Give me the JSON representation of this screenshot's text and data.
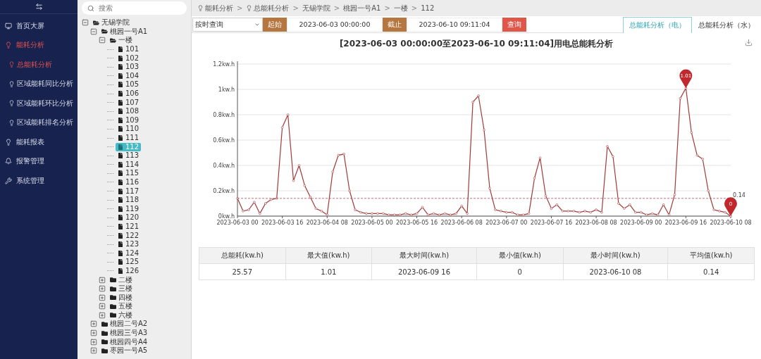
{
  "sidebar": {
    "items": [
      {
        "label": "首页大屏",
        "selected": false
      },
      {
        "label": "能耗分析",
        "selected": true,
        "children": [
          {
            "label": "总能耗分析",
            "selected": true
          },
          {
            "label": "区域能耗同比分析",
            "selected": false
          },
          {
            "label": "区域能耗环比分析",
            "selected": false
          },
          {
            "label": "区域能耗排名分析",
            "selected": false
          }
        ]
      },
      {
        "label": "能耗报表",
        "selected": false
      },
      {
        "label": "报警管理",
        "selected": false
      },
      {
        "label": "系统管理",
        "selected": false
      }
    ]
  },
  "tree": {
    "search": {
      "placeholder": "搜索"
    },
    "nodes": [
      {
        "label": "无锡学院",
        "kind": "folder",
        "expanded": true,
        "selected": false,
        "children": [
          {
            "label": "桃园一号A1",
            "kind": "folder",
            "expanded": true,
            "selected": false,
            "children": [
              {
                "label": "一楼",
                "kind": "folder",
                "expanded": true,
                "selected": false,
                "children": [
                  {
                    "label": "101",
                    "kind": "room",
                    "selected": false
                  },
                  {
                    "label": "102",
                    "kind": "room",
                    "selected": false
                  },
                  {
                    "label": "103",
                    "kind": "room",
                    "selected": false
                  },
                  {
                    "label": "104",
                    "kind": "room",
                    "selected": false
                  },
                  {
                    "label": "105",
                    "kind": "room",
                    "selected": false
                  },
                  {
                    "label": "106",
                    "kind": "room",
                    "selected": false
                  },
                  {
                    "label": "107",
                    "kind": "room",
                    "selected": false
                  },
                  {
                    "label": "108",
                    "kind": "room",
                    "selected": false
                  },
                  {
                    "label": "109",
                    "kind": "room",
                    "selected": false
                  },
                  {
                    "label": "110",
                    "kind": "room",
                    "selected": false
                  },
                  {
                    "label": "111",
                    "kind": "room",
                    "selected": false
                  },
                  {
                    "label": "112",
                    "kind": "room",
                    "selected": true
                  },
                  {
                    "label": "113",
                    "kind": "room",
                    "selected": false
                  },
                  {
                    "label": "114",
                    "kind": "room",
                    "selected": false
                  },
                  {
                    "label": "115",
                    "kind": "room",
                    "selected": false
                  },
                  {
                    "label": "116",
                    "kind": "room",
                    "selected": false
                  },
                  {
                    "label": "117",
                    "kind": "room",
                    "selected": false
                  },
                  {
                    "label": "118",
                    "kind": "room",
                    "selected": false
                  },
                  {
                    "label": "119",
                    "kind": "room",
                    "selected": false
                  },
                  {
                    "label": "120",
                    "kind": "room",
                    "selected": false
                  },
                  {
                    "label": "121",
                    "kind": "room",
                    "selected": false
                  },
                  {
                    "label": "122",
                    "kind": "room",
                    "selected": false
                  },
                  {
                    "label": "123",
                    "kind": "room",
                    "selected": false
                  },
                  {
                    "label": "124",
                    "kind": "room",
                    "selected": false
                  },
                  {
                    "label": "125",
                    "kind": "room",
                    "selected": false
                  },
                  {
                    "label": "126",
                    "kind": "room",
                    "selected": false
                  }
                ]
              },
              {
                "label": "二楼",
                "kind": "folder",
                "expanded": false,
                "selected": false
              },
              {
                "label": "三楼",
                "kind": "folder",
                "expanded": false,
                "selected": false
              },
              {
                "label": "四楼",
                "kind": "folder",
                "expanded": false,
                "selected": false
              },
              {
                "label": "五楼",
                "kind": "folder",
                "expanded": false,
                "selected": false
              },
              {
                "label": "六楼",
                "kind": "folder",
                "expanded": false,
                "selected": false
              }
            ]
          },
          {
            "label": "桃园二号A2",
            "kind": "folder",
            "expanded": false,
            "selected": false
          },
          {
            "label": "桃园三号A3",
            "kind": "folder",
            "expanded": false,
            "selected": false
          },
          {
            "label": "桃园四号A4",
            "kind": "folder",
            "expanded": false,
            "selected": false
          },
          {
            "label": "枣园一号A5",
            "kind": "folder",
            "expanded": false,
            "selected": false
          }
        ]
      }
    ]
  },
  "breadcrumb": {
    "separator": ">",
    "items": [
      "能耗分析",
      "总能耗分析",
      "无锡学院",
      "桃园一号A1",
      "一楼",
      "112"
    ]
  },
  "toolbar": {
    "query_mode": "按时查询",
    "start": {
      "label": "起始",
      "value": "2023-06-03 00:00:00"
    },
    "end": {
      "label": "截止",
      "value": "2023-06-10 09:11:04"
    },
    "search_button": "查询"
  },
  "tabs": [
    {
      "label": "总能耗分析（电）",
      "selected": true
    },
    {
      "label": "总能耗分析（水）",
      "selected": false
    }
  ],
  "chart": {
    "title": "[2023-06-03 00:00:00至2023-06-10 09:11:04]用电总能耗分析",
    "chart_data": {
      "type": "line",
      "categories": [
        "2023-06-03 00",
        null,
        null,
        null,
        null,
        null,
        null,
        null,
        "2023-06-03 16",
        null,
        null,
        null,
        null,
        null,
        null,
        null,
        "2023-06-04 08",
        null,
        null,
        null,
        null,
        null,
        null,
        null,
        "2023-06-05 00",
        null,
        null,
        null,
        null,
        null,
        null,
        null,
        "2023-06-05 16",
        null,
        null,
        null,
        null,
        null,
        null,
        null,
        "2023-06-06 08",
        null,
        null,
        null,
        null,
        null,
        null,
        null,
        "2023-06-07 00",
        null,
        null,
        null,
        null,
        null,
        null,
        null,
        "2023-06-07 16",
        null,
        null,
        null,
        null,
        null,
        null,
        null,
        "2023-06-08 08",
        null,
        null,
        null,
        null,
        null,
        null,
        null,
        "2023-06-09 00",
        null,
        null,
        null,
        null,
        null,
        null,
        null,
        "2023-06-09 16",
        null,
        null,
        null,
        null,
        null,
        null,
        null,
        "2023-06-10 08"
      ],
      "grid": true,
      "series": [
        {
          "color": "#a33a3a",
          "marker": "o",
          "values": [
            0.14,
            0.04,
            0.05,
            0.11,
            0.02,
            0.1,
            0.13,
            0.14,
            0.7,
            0.8,
            0.28,
            0.4,
            0.24,
            0.15,
            0.06,
            0.04,
            0.01,
            0.35,
            0.48,
            0.49,
            0.2,
            0.05,
            0.03,
            0.02,
            0.02,
            0.02,
            0.02,
            0.01,
            0.01,
            0.01,
            0.02,
            0.01,
            0.02,
            0.07,
            0.01,
            0.02,
            0.01,
            0.02,
            0.01,
            0.02,
            0.08,
            0.02,
            0.9,
            0.95,
            0.68,
            0.22,
            0.05,
            0.04,
            0.03,
            0.03,
            0.01,
            0.01,
            0.02,
            0.3,
            0.46,
            0.16,
            0.06,
            0.09,
            0.04,
            0.04,
            0.04,
            0.03,
            0.04,
            0.03,
            0.05,
            0.03,
            0.55,
            0.47,
            0.1,
            0.06,
            0.09,
            0.03,
            0.03,
            0.01,
            0.02,
            0.01,
            0.09,
            0.01,
            0.17,
            0.93,
            1.01,
            0.66,
            0.48,
            0.45,
            0.2,
            0.05,
            0.04,
            0.03,
            0
          ]
        }
      ],
      "ylim": [
        0,
        1.2
      ],
      "yticks": [
        {
          "value": 0,
          "label": "0kw.h"
        },
        {
          "value": 0.2,
          "label": "0.2kw.h"
        },
        {
          "value": 0.4,
          "label": "0.4kw.h"
        },
        {
          "value": 0.6,
          "label": "0.6kw.h"
        },
        {
          "value": 0.8,
          "label": "0.8kw.h"
        },
        {
          "value": 1,
          "label": "1kw.h"
        },
        {
          "value": 1.2,
          "label": "1.2kw.h"
        }
      ],
      "annotations": [
        {
          "text": "1.01",
          "x": "2023-06-09 16",
          "y": 1.01
        },
        {
          "text": "0",
          "x": "2023-06-10 08",
          "y": 0
        }
      ],
      "ref_lines": [
        {
          "axis": "y",
          "value": 0.14,
          "label": "0.14",
          "color": "#a33a3a"
        }
      ]
    }
  },
  "summary_table": {
    "columns": [
      "总能耗(kw.h)",
      "最大值(kw.h)",
      "最大时间(kw.h)",
      "最小值(kw.h)",
      "最小时间(kw.h)",
      "平均值(kw.h)"
    ],
    "rows": [
      [
        "25.57",
        "1.01",
        "2023-06-09 16",
        "0",
        "2023-06-10 08",
        "0.14"
      ]
    ]
  }
}
